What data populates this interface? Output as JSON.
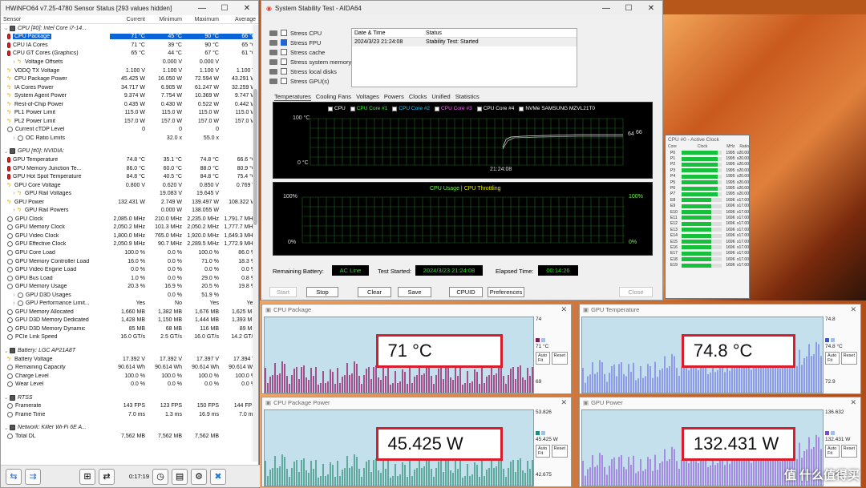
{
  "hwinfo": {
    "title": "HWiNFO64 v7.25-4780 Sensor Status [293 values hidden]",
    "columns": [
      "Sensor",
      "Current",
      "Minimum",
      "Maximum",
      "Average"
    ],
    "rows": [
      {
        "kind": "group",
        "label": "CPU [#0]: Intel Core i7-14...",
        "icon": "chip"
      },
      {
        "label": "CPU Package",
        "icon": "therm",
        "v": [
          "71 °C",
          "45 °C",
          "90 °C",
          "66 °C"
        ],
        "sel": true
      },
      {
        "label": "CPU IA Cores",
        "icon": "therm",
        "v": [
          "71 °C",
          "39 °C",
          "90 °C",
          "65 °C"
        ]
      },
      {
        "label": "CPU GT Cores (Graphics)",
        "icon": "therm",
        "v": [
          "65 °C",
          "44 °C",
          "67 °C",
          "61 °C"
        ]
      },
      {
        "label": "Voltage Offsets",
        "icon": "bolt",
        "sub": true,
        "v": [
          "",
          "0.000 V",
          "0.000 V",
          ""
        ]
      },
      {
        "label": "VDDQ TX Voltage",
        "icon": "bolt",
        "v": [
          "1.100 V",
          "1.100 V",
          "1.100 V",
          "1.100 V"
        ]
      },
      {
        "label": "CPU Package Power",
        "icon": "bolt",
        "v": [
          "45.425 W",
          "16.050 W",
          "72.594 W",
          "43.291 W"
        ]
      },
      {
        "label": "IA Cores Power",
        "icon": "bolt",
        "v": [
          "34.717 W",
          "6.905 W",
          "61.247 W",
          "32.259 W"
        ]
      },
      {
        "label": "System Agent Power",
        "icon": "bolt",
        "v": [
          "9.374 W",
          "7.754 W",
          "10.369 W",
          "9.747 W"
        ]
      },
      {
        "label": "Rest-of-Chip Power",
        "icon": "bolt",
        "v": [
          "0.435 W",
          "0.430 W",
          "0.522 W",
          "0.442 W"
        ]
      },
      {
        "label": "PL1 Power Limit",
        "icon": "bolt",
        "v": [
          "115.0 W",
          "115.0 W",
          "115.0 W",
          "115.0 W"
        ]
      },
      {
        "label": "PL2 Power Limit",
        "icon": "bolt",
        "v": [
          "157.0 W",
          "157.0 W",
          "157.0 W",
          "157.0 W"
        ]
      },
      {
        "label": "Current cTDP Level",
        "icon": "gauge",
        "v": [
          "0",
          "0",
          "0",
          "0"
        ]
      },
      {
        "label": "OC Ratio Limits",
        "icon": "gauge",
        "sub": true,
        "v": [
          "",
          "32.0 x",
          "55.0 x",
          ""
        ]
      },
      {
        "kind": "sep"
      },
      {
        "kind": "group",
        "label": "GPU [#0]: NVIDIA:",
        "icon": "chip"
      },
      {
        "label": "GPU Temperature",
        "icon": "therm",
        "v": [
          "74.8 °C",
          "35.1 °C",
          "74.8 °C",
          "66.6 °C"
        ]
      },
      {
        "label": "GPU Memory Junction Te...",
        "icon": "therm",
        "v": [
          "86.0 °C",
          "60.0 °C",
          "88.0 °C",
          "80.9 °C"
        ]
      },
      {
        "label": "GPU Hot Spot Temperature",
        "icon": "therm",
        "v": [
          "84.8 °C",
          "40.5 °C",
          "84.8 °C",
          "75.4 °C"
        ]
      },
      {
        "label": "GPU Core Voltage",
        "icon": "bolt",
        "v": [
          "0.800 V",
          "0.620 V",
          "0.850 V",
          "0.769 V"
        ]
      },
      {
        "label": "GPU Rail Voltages",
        "icon": "bolt",
        "sub": true,
        "v": [
          "",
          "19.083 V",
          "19.645 V",
          ""
        ]
      },
      {
        "label": "GPU Power",
        "icon": "bolt",
        "v": [
          "132.431 W",
          "2.749 W",
          "139.497 W",
          "108.322 W"
        ]
      },
      {
        "label": "GPU Rail Powers",
        "icon": "bolt",
        "sub": true,
        "v": [
          "",
          "0.000 W",
          "138.055 W",
          ""
        ]
      },
      {
        "label": "GPU Clock",
        "icon": "gauge",
        "v": [
          "2,085.0 MHz",
          "210.0 MHz",
          "2,235.0 MHz",
          "1,791.7 MHz"
        ]
      },
      {
        "label": "GPU Memory Clock",
        "icon": "gauge",
        "v": [
          "2,050.2 MHz",
          "101.3 MHz",
          "2,050.2 MHz",
          "1,777.7 MHz"
        ]
      },
      {
        "label": "GPU Video Clock",
        "icon": "gauge",
        "v": [
          "1,800.0 MHz",
          "765.0 MHz",
          "1,920.0 MHz",
          "1,649.3 MHz"
        ]
      },
      {
        "label": "GPU Effective Clock",
        "icon": "gauge",
        "v": [
          "2,050.9 MHz",
          "90.7 MHz",
          "2,289.5 MHz",
          "1,772.9 MHz"
        ]
      },
      {
        "label": "GPU Core Load",
        "icon": "gauge",
        "v": [
          "100.0 %",
          "0.0 %",
          "100.0 %",
          "86.0 %"
        ]
      },
      {
        "label": "GPU Memory Controller Load",
        "icon": "gauge",
        "v": [
          "16.0 %",
          "0.0 %",
          "71.0 %",
          "18.3 %"
        ]
      },
      {
        "label": "GPU Video Engine Load",
        "icon": "gauge",
        "v": [
          "0.0 %",
          "0.0 %",
          "0.0 %",
          "0.0 %"
        ]
      },
      {
        "label": "GPU Bus Load",
        "icon": "gauge",
        "v": [
          "1.0 %",
          "0.0 %",
          "29.0 %",
          "0.8 %"
        ]
      },
      {
        "label": "GPU Memory Usage",
        "icon": "gauge",
        "v": [
          "20.3 %",
          "16.9 %",
          "20.5 %",
          "19.8 %"
        ]
      },
      {
        "label": "GPU D3D Usages",
        "icon": "gauge",
        "sub": true,
        "v": [
          "",
          "0.0 %",
          "51.9 %",
          ""
        ]
      },
      {
        "label": "GPU Performance Limit...",
        "icon": "gauge",
        "sub": true,
        "v": [
          "Yes",
          "No",
          "Yes",
          "Yes"
        ]
      },
      {
        "label": "GPU Memory Allocated",
        "icon": "gauge",
        "v": [
          "1,660 MB",
          "1,382 MB",
          "1,676 MB",
          "1,625 MB"
        ]
      },
      {
        "label": "GPU D3D Memory Dedicated",
        "icon": "gauge",
        "v": [
          "1,428 MB",
          "1,150 MB",
          "1,444 MB",
          "1,393 MB"
        ]
      },
      {
        "label": "GPU D3D Memory Dynamic",
        "icon": "gauge",
        "v": [
          "85 MB",
          "68 MB",
          "116 MB",
          "89 MB"
        ]
      },
      {
        "label": "PCIe Link Speed",
        "icon": "gauge",
        "v": [
          "16.0 GT/s",
          "2.5 GT/s",
          "16.0 GT/s",
          "14.2 GT/s"
        ]
      },
      {
        "kind": "sep"
      },
      {
        "kind": "group",
        "label": "Battery: LGC AP21A8T",
        "icon": "chip"
      },
      {
        "label": "Battery Voltage",
        "icon": "bolt",
        "v": [
          "17.392 V",
          "17.392 V",
          "17.397 V",
          "17.394 V"
        ]
      },
      {
        "label": "Remaining Capacity",
        "icon": "gauge",
        "v": [
          "90.614 Wh",
          "90.614 Wh",
          "90.614 Wh",
          "90.614 Wh"
        ]
      },
      {
        "label": "Charge Level",
        "icon": "gauge",
        "v": [
          "100.0 %",
          "100.0 %",
          "100.0 %",
          "100.0 %"
        ]
      },
      {
        "label": "Wear Level",
        "icon": "gauge",
        "v": [
          "0.0 %",
          "0.0 %",
          "0.0 %",
          "0.0 %"
        ]
      },
      {
        "kind": "sep"
      },
      {
        "kind": "group",
        "label": "RTSS",
        "icon": "chip"
      },
      {
        "label": "Framerate",
        "icon": "gauge",
        "v": [
          "143 FPS",
          "123 FPS",
          "150 FPS",
          "144 FPS"
        ]
      },
      {
        "label": "Frame Time",
        "icon": "gauge",
        "v": [
          "7.0 ms",
          "1.3 ms",
          "16.9 ms",
          "7.0 ms"
        ]
      },
      {
        "kind": "sep"
      },
      {
        "kind": "group",
        "label": "Network: Killer Wi-Fi 6E A...",
        "icon": "chip"
      },
      {
        "label": "Total DL",
        "icon": "gauge",
        "v": [
          "7,562 MB",
          "7,562 MB",
          "7,562 MB",
          ""
        ]
      }
    ],
    "elapsed": "0:17:19"
  },
  "aida": {
    "title": "System Stability Test - AIDA64",
    "stress": [
      "Stress CPU",
      "Stress FPU",
      "Stress cache",
      "Stress system memory",
      "Stress local disks",
      "Stress GPU(s)"
    ],
    "stress_checked": [
      false,
      true,
      false,
      false,
      false,
      false
    ],
    "log_headers": [
      "Date & Time",
      "Status"
    ],
    "log_row": [
      "2024/3/23 21:24:08",
      "Stability Test: Started"
    ],
    "tabs": [
      "Temperatures",
      "Cooling Fans",
      "Voltages",
      "Powers",
      "Clocks",
      "Unified",
      "Statistics"
    ],
    "legend": [
      "CPU",
      "CPU Core #1",
      "CPU Core #2",
      "CPU Core #3",
      "CPU Core #4",
      "NVMe SAMSUNG MZVL21T0"
    ],
    "legend_colors": [
      "#ffffff",
      "#33ff33",
      "#33ccff",
      "#ff66ff",
      "#ffffff",
      "#ffffff"
    ],
    "temp_top": "100 °C",
    "temp_bottom": "0 °C",
    "temp_time": "21:24:08",
    "temp_val": "64",
    "temp_val2": "66",
    "usage_title_a": "CPU Usage",
    "usage_sep": "|",
    "usage_title_b": "CPU Throttling",
    "pct100": "100%",
    "pct0": "0%",
    "battery_label": "Remaining Battery:",
    "battery_value": "AC Line",
    "started_label": "Test Started:",
    "started_value": "2024/3/23 21:24:08",
    "elapsed_label": "Elapsed Time:",
    "elapsed_value": "00:14:26",
    "buttons": [
      "Start",
      "Stop",
      "Clear",
      "Save",
      "CPUID",
      "Preferences",
      "Close"
    ]
  },
  "clock": {
    "title": "CPU #0 - Active Clock",
    "headers": [
      "Core",
      "Clock",
      "MHz",
      "Ratio"
    ],
    "cores": [
      [
        "P0",
        "1995",
        "x20.00",
        0.9
      ],
      [
        "P1",
        "1995",
        "x20.00",
        0.9
      ],
      [
        "P2",
        "1995",
        "x20.00",
        0.9
      ],
      [
        "P3",
        "1995",
        "x20.00",
        0.9
      ],
      [
        "P4",
        "1995",
        "x20.00",
        0.9
      ],
      [
        "P5",
        "1995",
        "x20.00",
        0.9
      ],
      [
        "P6",
        "1995",
        "x20.00",
        0.9
      ],
      [
        "P7",
        "1995",
        "x20.00",
        0.9
      ],
      [
        "E8",
        "1696",
        "x17.00",
        0.75
      ],
      [
        "E9",
        "1696",
        "x17.00",
        0.75
      ],
      [
        "E10",
        "1696",
        "x17.00",
        0.75
      ],
      [
        "E11",
        "1696",
        "x17.00",
        0.75
      ],
      [
        "E12",
        "1696",
        "x17.00",
        0.75
      ],
      [
        "E13",
        "1696",
        "x17.00",
        0.75
      ],
      [
        "E14",
        "1696",
        "x17.00",
        0.75
      ],
      [
        "E15",
        "1696",
        "x17.00",
        0.75
      ],
      [
        "E16",
        "1696",
        "x17.00",
        0.75
      ],
      [
        "E17",
        "1696",
        "x17.00",
        0.75
      ],
      [
        "E18",
        "1696",
        "x17.00",
        0.75
      ],
      [
        "E19",
        "1696",
        "x17.00",
        0.75
      ]
    ]
  },
  "monitors": [
    {
      "title": "CPU Package",
      "value": "71 °C",
      "max": "74",
      "cur": "71 °C",
      "min": "69",
      "color": "#7a1f55",
      "fill": "#a0508a"
    },
    {
      "title": "GPU Temperature",
      "value": "74.8 °C",
      "max": "74.8",
      "cur": "74.8 °C",
      "min": "72.9",
      "color": "#3a56c8",
      "fill": "#8f9be6"
    },
    {
      "title": "CPU Package Power",
      "value": "45.425 W",
      "max": "53.826",
      "cur": "45.425 W",
      "min": "42.675",
      "color": "#1f8a7a",
      "fill": "#5fa89c"
    },
    {
      "title": "GPU Power",
      "value": "132.431 W",
      "max": "136.632",
      "cur": "132.431 W",
      "min": "121.617",
      "color": "#7a4ed0",
      "fill": "#a48be0"
    }
  ],
  "autofit": "Auto Fit",
  "reset": "Reset",
  "watermark": "值 什么值得买"
}
